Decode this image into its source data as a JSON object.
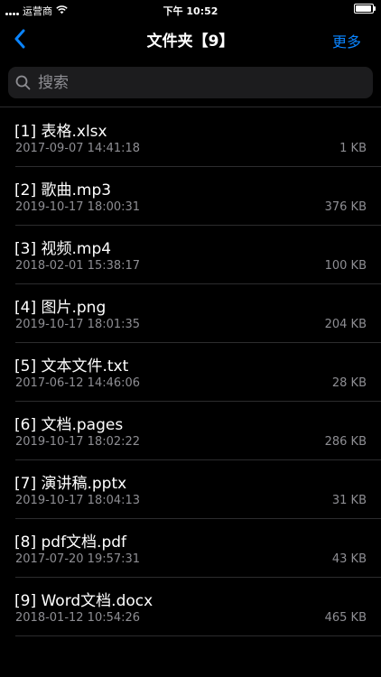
{
  "status": {
    "carrier": "运营商",
    "time": "下午 10:52"
  },
  "nav": {
    "title": "文件夹【9】",
    "more_label": "更多"
  },
  "search": {
    "placeholder": "搜索"
  },
  "files": [
    {
      "name": "[1] 表格.xlsx",
      "date": "2017-09-07 14:41:18",
      "size": "1 KB"
    },
    {
      "name": "[2] 歌曲.mp3",
      "date": "2019-10-17 18:00:31",
      "size": "376 KB"
    },
    {
      "name": "[3] 视频.mp4",
      "date": "2018-02-01 15:38:17",
      "size": "100 KB"
    },
    {
      "name": "[4] 图片.png",
      "date": "2019-10-17 18:01:35",
      "size": "204 KB"
    },
    {
      "name": "[5] 文本文件.txt",
      "date": "2017-06-12 14:46:06",
      "size": "28 KB"
    },
    {
      "name": "[6] 文档.pages",
      "date": "2019-10-17 18:02:22",
      "size": "286 KB"
    },
    {
      "name": "[7] 演讲稿.pptx",
      "date": "2019-10-17 18:04:13",
      "size": "31 KB"
    },
    {
      "name": "[8] pdf文档.pdf",
      "date": "2017-07-20 19:57:31",
      "size": "43 KB"
    },
    {
      "name": "[9] Word文档.docx",
      "date": "2018-01-12 10:54:26",
      "size": "465 KB"
    }
  ],
  "colors": {
    "accent": "#0a84ff",
    "background": "#000000",
    "secondary_text": "#8e8e93"
  },
  "icons": {
    "back": "chevron-left-icon",
    "search": "search-icon",
    "wifi": "wifi-icon",
    "battery": "battery-icon"
  }
}
